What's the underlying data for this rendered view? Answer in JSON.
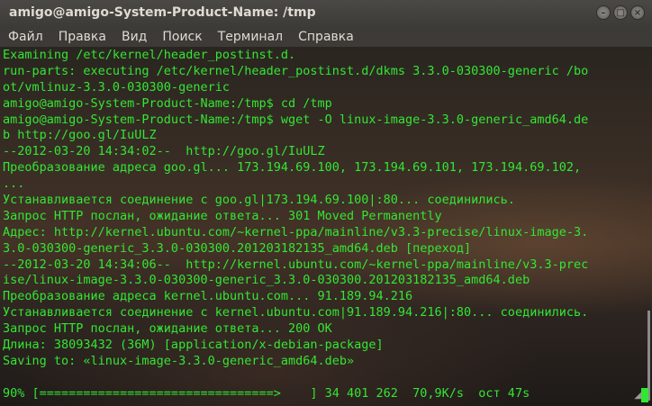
{
  "window": {
    "title": "amigo@amigo-System-Product-Name: /tmp",
    "buttons": {
      "minimize": "–",
      "maximize": "□",
      "close": "×"
    }
  },
  "menu": [
    "Файл",
    "Правка",
    "Вид",
    "Поиск",
    "Терминал",
    "Справка"
  ],
  "terminal": {
    "text_color": "#33e633",
    "lines": [
      "Examining /etc/kernel/header_postinst.d.",
      "run-parts: executing /etc/kernel/header_postinst.d/dkms 3.3.0-030300-generic /bo",
      "ot/vmlinuz-3.3.0-030300-generic",
      "amigo@amigo-System-Product-Name:/tmp$ cd /tmp",
      "amigo@amigo-System-Product-Name:/tmp$ wget -O linux-image-3.3.0-generic_amd64.de",
      "b http://goo.gl/IuULZ",
      "--2012-03-20 14:34:02--  http://goo.gl/IuULZ",
      "Преобразование адреса goo.gl... 173.194.69.100, 173.194.69.101, 173.194.69.102,",
      "...",
      "Устанавливается соединение с goo.gl|173.194.69.100|:80... соединились.",
      "Запрос HTTP послан, ожидание ответа... 301 Moved Permanently",
      "Адрес: http://kernel.ubuntu.com/~kernel-ppa/mainline/v3.3-precise/linux-image-3.",
      "3.0-030300-generic_3.3.0-030300.201203182135_amd64.deb [переход]",
      "--2012-03-20 14:34:06--  http://kernel.ubuntu.com/~kernel-ppa/mainline/v3.3-prec",
      "ise/linux-image-3.3.0-030300-generic_3.3.0-030300.201203182135_amd64.deb",
      "Преобразование адреса kernel.ubuntu.com... 91.189.94.216",
      "Устанавливается соединение с kernel.ubuntu.com|91.189.94.216|:80... соединились.",
      "Запрос HTTP послан, ожидание ответа... 200 OK",
      "Длина: 38093432 (36M) [application/x-debian-package]",
      "Saving to: «linux-image-3.3.0-generic_amd64.deb»"
    ],
    "progress_line": "90% [================================>    ] 34 401 262  70,9K/s  ост 47s",
    "progress_percent": 90
  }
}
